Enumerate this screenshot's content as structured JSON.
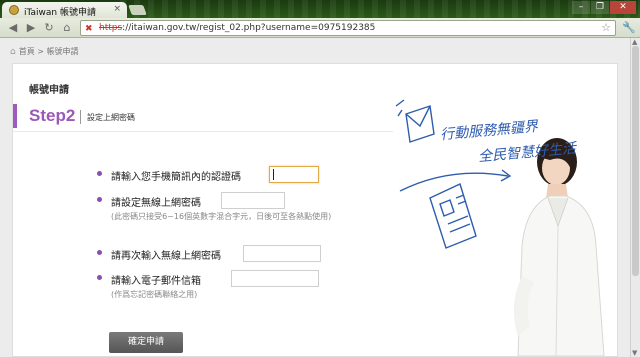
{
  "browser": {
    "tab_title": "iTaiwan 帳號申請",
    "tab_close": "×",
    "url_scheme": "https",
    "url_rest": "://itaiwan.gov.tw/regist_02.php?username=0975192385",
    "window_buttons": [
      "–",
      "❐",
      "✕"
    ]
  },
  "page": {
    "breadcrumb": "首頁 > 帳號申請",
    "panel_title": "帳號申請",
    "step_label": "Step2",
    "step_desc": "設定上網密碼",
    "fields": [
      {
        "label": "請輸入您手機簡訊內的認證碼",
        "value": "",
        "focused": true
      },
      {
        "label": "請設定無線上網密碼",
        "value": "",
        "note": "(此密碼只接受6~16個英數字混合字元，日後可至各熱點使用)"
      },
      {
        "label": "請再次輸入無線上網密碼",
        "value": ""
      },
      {
        "label": "請輸入電子郵件信箱",
        "value": "",
        "note": "(作爲忘記密碼聯絡之用)"
      }
    ],
    "submit_label": "確定申請",
    "slogan_line1": "行動服務無疆界",
    "slogan_line2": "全民智慧好生活"
  },
  "colors": {
    "accent": "#9b58b8",
    "chrome_dark": "#1b3a10"
  }
}
